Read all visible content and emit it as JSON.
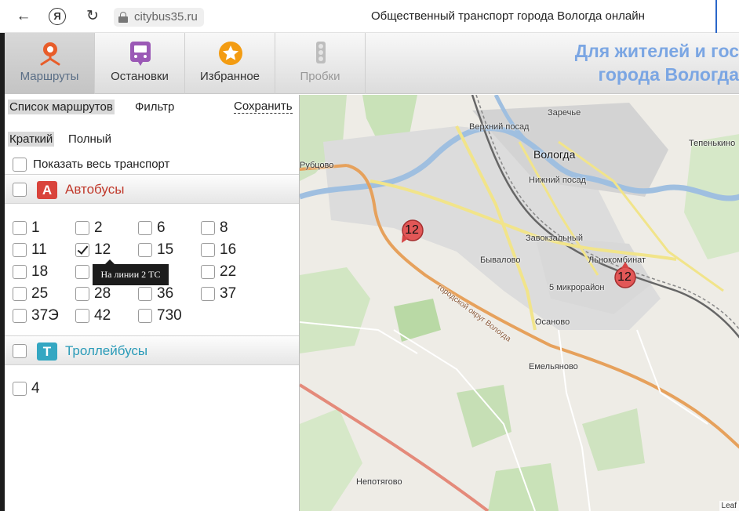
{
  "browser": {
    "url": "citybus35.ru",
    "title": "Общественный транспорт города Вологда онлайн"
  },
  "toolbar": {
    "buttons": [
      {
        "label": "Маршруты",
        "icon": "route-pin-icon",
        "active": true
      },
      {
        "label": "Остановки",
        "icon": "bus-icon",
        "active": false
      },
      {
        "label": "Избранное",
        "icon": "star-icon",
        "active": false
      },
      {
        "label": "Пробки",
        "icon": "traffic-light-icon",
        "active": false,
        "disabled": true
      }
    ],
    "banner_line1": "Для жителей и гос",
    "banner_line2": "города Вологда"
  },
  "sidebar": {
    "tabs": [
      {
        "label": "Список маршрутов",
        "selected": true
      },
      {
        "label": "Фильтр",
        "selected": false
      }
    ],
    "save_label": "Сохранить",
    "modes": [
      {
        "label": "Краткий",
        "selected": true
      },
      {
        "label": "Полный",
        "selected": false
      }
    ],
    "show_all_label": "Показать весь транспорт",
    "bus_section": {
      "badge": "А",
      "name": "Автобусы",
      "color": "#c0392b",
      "badge_color": "#d9433b",
      "routes": [
        {
          "n": "1",
          "checked": false
        },
        {
          "n": "2",
          "checked": false
        },
        {
          "n": "6",
          "checked": false
        },
        {
          "n": "8",
          "checked": false
        },
        {
          "n": "11",
          "checked": false
        },
        {
          "n": "12",
          "checked": true
        },
        {
          "n": "15",
          "checked": false
        },
        {
          "n": "16",
          "checked": false
        },
        {
          "n": "18",
          "checked": false
        },
        {
          "n": "",
          "checked": false
        },
        {
          "n": "1",
          "checked": false
        },
        {
          "n": "22",
          "checked": false
        },
        {
          "n": "25",
          "checked": false
        },
        {
          "n": "28",
          "checked": false
        },
        {
          "n": "36",
          "checked": false
        },
        {
          "n": "37",
          "checked": false
        },
        {
          "n": "37Э",
          "checked": false
        },
        {
          "n": "42",
          "checked": false
        },
        {
          "n": "730",
          "checked": false
        }
      ]
    },
    "tooltip": "На линии 2 ТС",
    "trolley_section": {
      "badge": "Т",
      "name": "Троллейбусы",
      "color": "#2a9bb8",
      "badge_color": "#34a7c2",
      "routes": [
        {
          "n": "4",
          "checked": false
        }
      ]
    }
  },
  "map": {
    "labels": {
      "verkhniy_posad": "Верхний посад",
      "zarechye": "Заречье",
      "vologda": "Вологда",
      "tepenkino": "Тепенькино",
      "rubtsovo": "Рубцово",
      "nizhniy_posad": "Нижний посад",
      "zavokzalny": "Завокзальный",
      "byvalovo": "Бывалово",
      "lnokombinat": "Льнокомбинат",
      "pyat_mikrorayon": "5 микрорайон",
      "osanovo": "Осаново",
      "emelyanovo": "Емельяново",
      "nepotyagovo": "Непотягово",
      "gorodskoy_okrug": "городской округ Вологда"
    },
    "markers": [
      {
        "route": "12"
      },
      {
        "route": "12"
      }
    ],
    "attribution": "Leaf"
  }
}
